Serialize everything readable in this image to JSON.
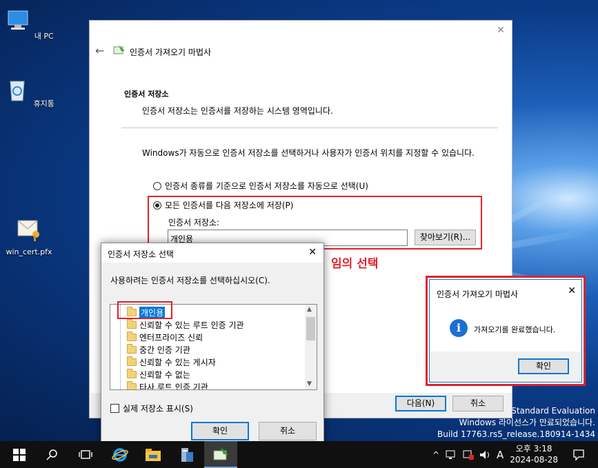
{
  "desktop": {
    "icons": [
      {
        "label": "내 PC",
        "icon": "computer-icon"
      },
      {
        "label": "휴지통",
        "icon": "recycle-bin-icon"
      },
      {
        "label": "win_cert.pfx",
        "icon": "certificate-file-icon"
      }
    ],
    "watermark": {
      "line1": "19 Standard Evaluation",
      "line2": "Windows 라이선스가 만료되었습니다.",
      "line3": "Build 17763.rs5_release.180914-1434"
    }
  },
  "wizard": {
    "title": "인증서 가져오기 마법사",
    "section_title": "인증서 저장소",
    "section_desc": "인증서 저장소는 인증서를 저장하는 시스템 영역입니다.",
    "intro": "Windows가 자동으로 인증서 저장소를 선택하거나 사용자가 인증서 위치를 지정할 수 있습니다.",
    "radio_auto": "인증서 종류를 기준으로 인증서 저장소를 자동으로 선택(U)",
    "radio_manual": "모든 인증서를 다음 저장소에 저장(P)",
    "store_label": "인증서 저장소:",
    "store_value": "개인용",
    "browse_button": "찾아보기(R)...",
    "next_button": "다음(N)",
    "cancel_button": "취소"
  },
  "annotation": "임의 선택",
  "store_picker": {
    "title": "인증서 저장소 선택",
    "prompt": "사용하려는 인증서 저장소를 선택하십시오(C).",
    "items": [
      "개인용",
      "신뢰할 수 있는 루트 인증 기관",
      "엔터프라이즈 신뢰",
      "중간 인증 기관",
      "신뢰할 수 있는 게시자",
      "신뢰할 수 없는",
      "타사 루트 인증 기관"
    ],
    "selected": "개인용",
    "show_physical": "실제 저장소 표시(S)",
    "ok_button": "확인",
    "cancel_button": "취소"
  },
  "done_dialog": {
    "title": "인증서 가져오기 마법사",
    "message": "가져오기를 완료했습니다.",
    "ok_button": "확인"
  },
  "taskbar": {
    "time": "오후 3:18",
    "date": "2024-08-28",
    "ime": "A"
  }
}
